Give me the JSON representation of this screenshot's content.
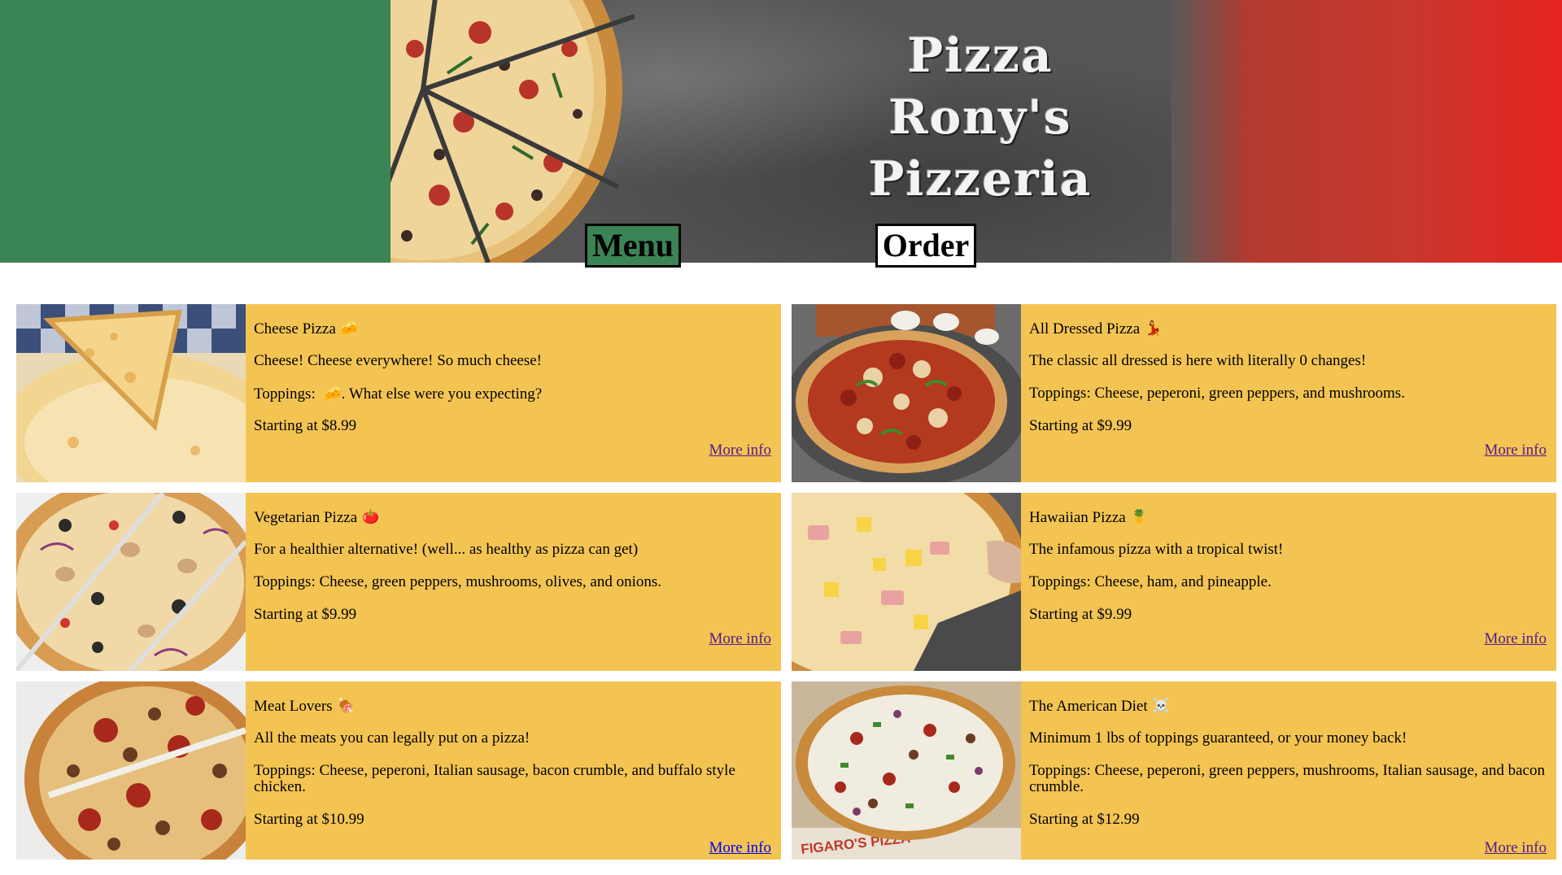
{
  "header": {
    "brand_line1": "Pizza",
    "brand_line2": "Rony's",
    "brand_line3": "Pizzeria",
    "nav": {
      "menu": "Menu",
      "order": "Order"
    },
    "colors": {
      "green": "#3b8455",
      "red": "#e52420",
      "board": "#555555"
    }
  },
  "card_color": "#f4c453",
  "cards": [
    {
      "title": "Cheese Pizza",
      "emoji": "🧀",
      "description": "Cheese! Cheese everywhere! So much cheese!",
      "toppings_prefix": "Toppings: ",
      "toppings_emoji": "🧀",
      "toppings": ". What else were you expecting?",
      "price": "Starting at $8.99",
      "link": "More info"
    },
    {
      "title": "All Dressed Pizza",
      "emoji": "💃",
      "description": "The classic all dressed is here with literally 0 changes!",
      "toppings": "Toppings: Cheese, peperoni, green peppers, and mushrooms.",
      "price": "Starting at $9.99",
      "link": "More info"
    },
    {
      "title": "Vegetarian Pizza",
      "emoji": "🍅",
      "description": "For a healthier alternative! (well... as healthy as pizza can get)",
      "toppings": "Toppings: Cheese, green peppers, mushrooms, olives, and onions.",
      "price": "Starting at $9.99",
      "link": "More info"
    },
    {
      "title": "Hawaiian Pizza",
      "emoji": "🍍",
      "description": "The infamous pizza with a tropical twist!",
      "toppings": "Toppings: Cheese, ham, and pineapple.",
      "price": "Starting at $9.99",
      "link": "More info"
    },
    {
      "title": "Meat Lovers",
      "emoji": "🍖",
      "description": "All the meats you can legally put on a pizza!",
      "toppings": "Toppings: Cheese, peperoni, Italian sausage, bacon crumble, and buffalo style chicken.",
      "price": "Starting at $10.99",
      "link": "More info"
    },
    {
      "title": "The American Diet",
      "emoji": "☠️",
      "description": "Minimum 1 lbs of toppings guaranteed, or your money back!",
      "toppings": "Toppings: Cheese, peperoni, green peppers, mushrooms, Italian sausage, and bacon crumble.",
      "price": "Starting at $12.99",
      "link": "More info"
    }
  ],
  "box_print": "FIGARO'S PIZZA"
}
